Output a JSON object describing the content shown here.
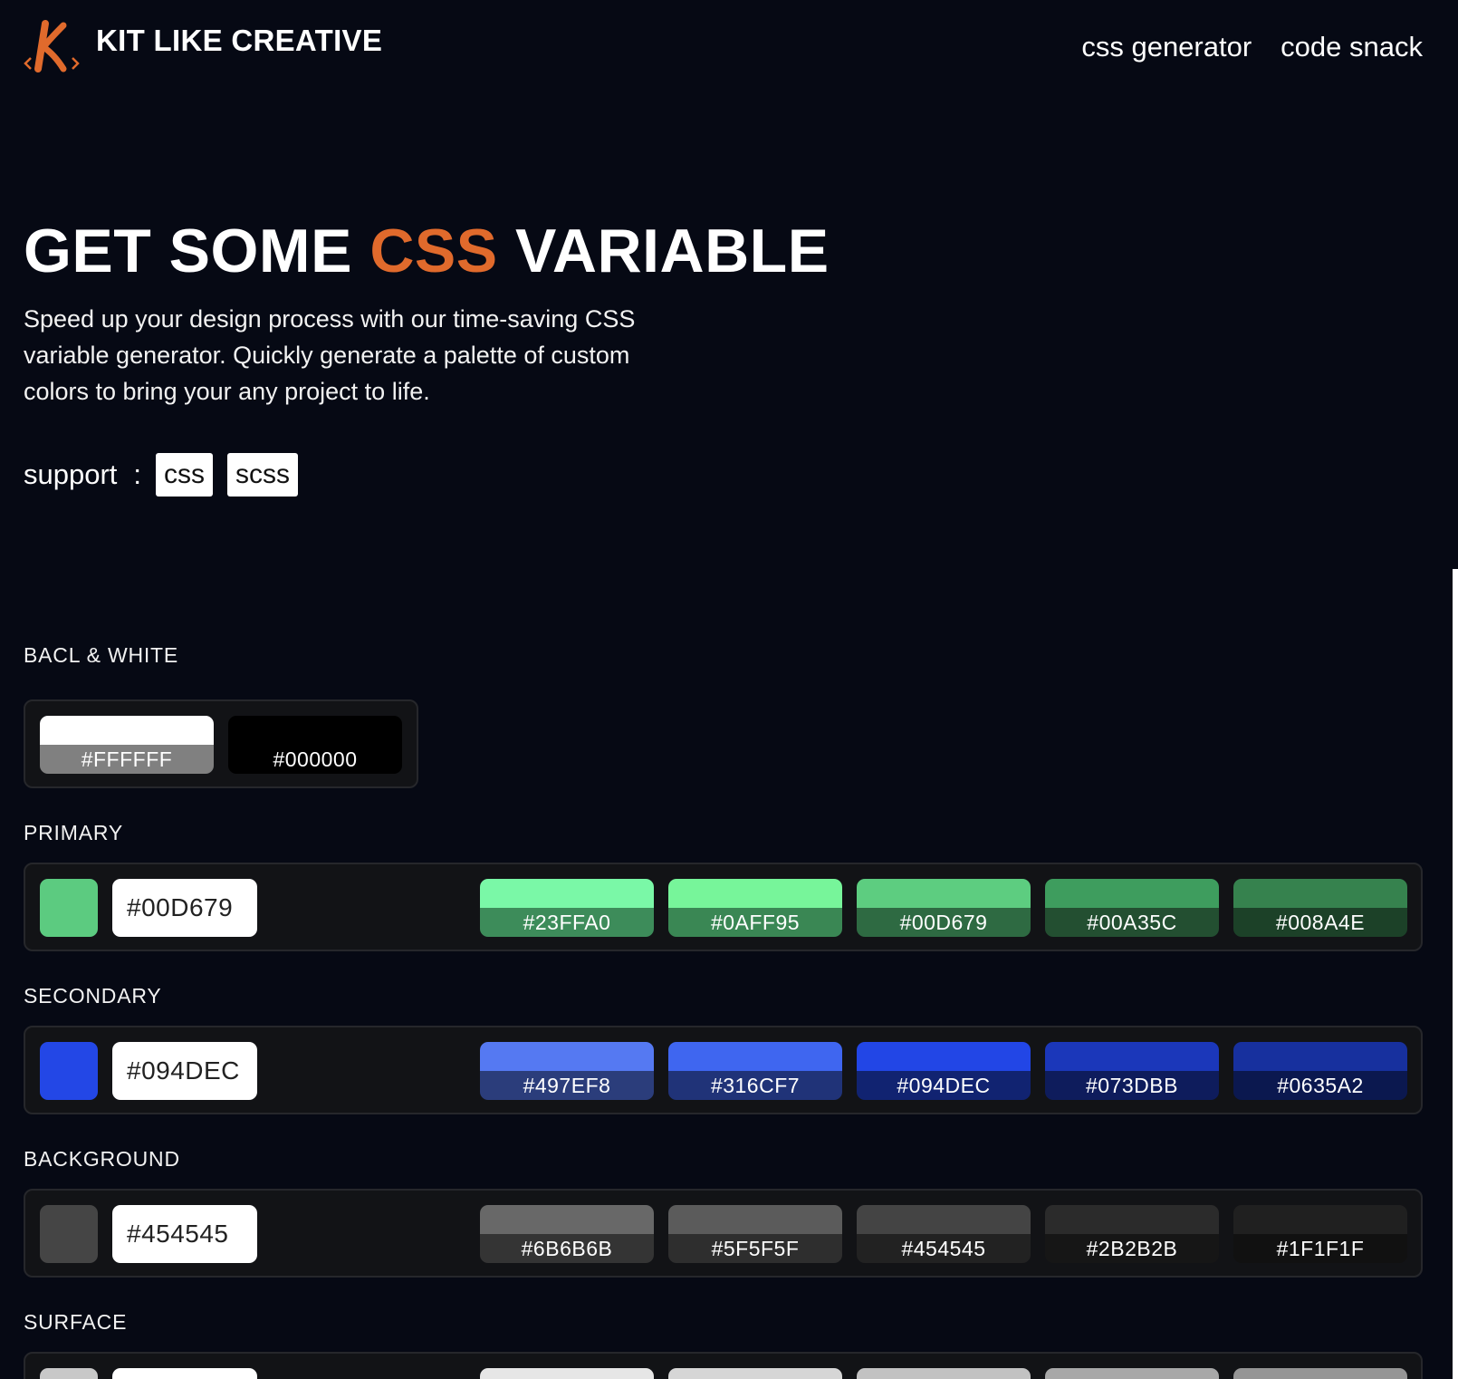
{
  "header": {
    "brand": "KIT LIKE CREATIVE",
    "logo_letter": "K",
    "nav": [
      "css generator",
      "code snack"
    ]
  },
  "hero": {
    "title_pre": "GET SOME ",
    "title_accent": "CSS",
    "title_post": " VARIABLE",
    "description": "Speed up your design process with our time-saving CSS variable generator. Quickly generate a palette of custom colors to bring your any project to life.",
    "support_label": "support",
    "support_colon": ":",
    "support_options": [
      "css",
      "scss"
    ]
  },
  "colors": {
    "accent": "#E06A2C",
    "page_bg": "#060914"
  },
  "sections": [
    {
      "title": "BACL & WHITE",
      "swatches": [
        {
          "label": "#FFFFFF",
          "top": "#FFFFFF",
          "bottom": "#808080"
        },
        {
          "label": "#000000",
          "top": "#000000",
          "bottom": "#000000"
        }
      ]
    },
    {
      "title": "PRIMARY",
      "base_color": "#5CCB80",
      "value": "#00D679",
      "swatches": [
        {
          "label": "#23FFA0",
          "top": "#7AF8A7",
          "bottom": "#3D8C5A"
        },
        {
          "label": "#0AFF95",
          "top": "#77F59A",
          "bottom": "#3A8754"
        },
        {
          "label": "#00D679",
          "top": "#5DCD80",
          "bottom": "#2E6A42"
        },
        {
          "label": "#00A35C",
          "top": "#3E9D5E",
          "bottom": "#234F31"
        },
        {
          "label": "#008A4E",
          "top": "#36824E",
          "bottom": "#1C4128"
        }
      ]
    },
    {
      "title": "SECONDARY",
      "base_color": "#2347E6",
      "value": "#094DEC",
      "swatches": [
        {
          "label": "#497EF8",
          "top": "#5579F2",
          "bottom": "#2B3D7B"
        },
        {
          "label": "#316CF7",
          "top": "#3F66F0",
          "bottom": "#203378"
        },
        {
          "label": "#094DEC",
          "top": "#2246E6",
          "bottom": "#112371"
        },
        {
          "label": "#073DBB",
          "top": "#1B37BA",
          "bottom": "#0E1C5C"
        },
        {
          "label": "#0635A2",
          "top": "#17309E",
          "bottom": "#0B184F"
        }
      ]
    },
    {
      "title": "BACKGROUND",
      "base_color": "#454545",
      "value": "#454545",
      "swatches": [
        {
          "label": "#6B6B6B",
          "top": "#686868",
          "bottom": "#343434"
        },
        {
          "label": "#5F5F5F",
          "top": "#5B5B5B",
          "bottom": "#2E2E2E"
        },
        {
          "label": "#454545",
          "top": "#444444",
          "bottom": "#222222"
        },
        {
          "label": "#2B2B2B",
          "top": "#2B2B2B",
          "bottom": "#161616"
        },
        {
          "label": "#1F1F1F",
          "top": "#202020",
          "bottom": "#111111"
        }
      ]
    },
    {
      "title": "SURFACE"
    }
  ]
}
